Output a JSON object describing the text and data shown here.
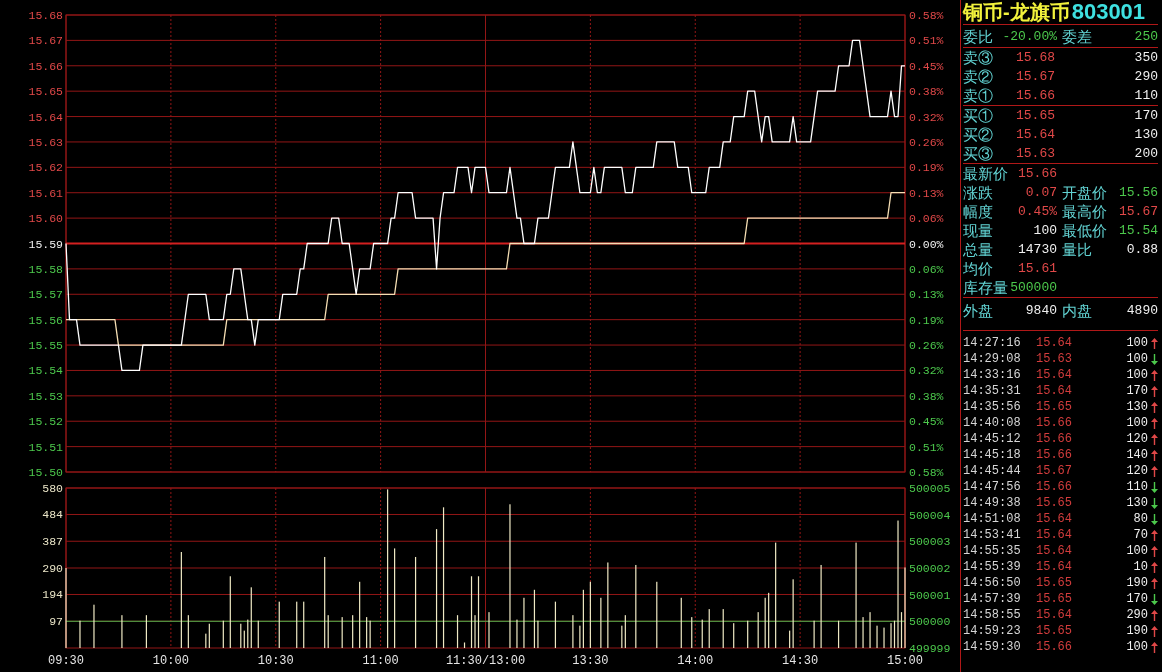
{
  "price_chart": {
    "chart_data": {
      "type": "line",
      "grid": true,
      "categories": [
        null,
        null,
        null,
        null,
        null,
        null,
        null,
        null,
        null,
        null,
        null,
        null,
        null,
        null,
        null,
        null,
        null,
        null,
        null,
        null,
        null,
        null,
        null,
        null,
        null,
        null,
        null,
        null,
        null,
        null,
        null,
        null,
        null,
        null,
        null,
        null,
        null,
        null,
        null,
        null,
        null,
        null,
        null,
        null,
        null,
        null,
        null,
        null,
        null,
        null,
        null,
        null,
        null,
        null,
        null,
        null,
        null,
        null,
        null,
        null,
        null,
        null,
        null,
        null,
        null,
        null,
        null,
        null,
        null,
        null,
        null,
        null,
        null,
        null,
        null,
        null,
        null,
        null,
        null,
        null,
        null,
        null,
        null,
        null,
        null,
        null,
        null,
        null,
        null,
        null,
        null,
        null,
        null,
        null,
        null,
        null,
        null,
        null,
        null,
        null,
        null,
        null,
        null,
        null,
        null,
        null,
        null,
        null,
        null,
        null,
        null,
        null,
        null,
        null,
        null,
        null,
        null,
        null,
        null,
        null,
        null,
        null,
        null,
        null,
        null,
        null,
        null,
        null,
        null,
        null,
        null,
        null,
        null,
        null,
        null,
        null,
        null,
        null,
        null,
        null,
        null,
        null,
        null,
        null,
        null,
        null,
        null,
        null,
        null,
        null,
        null,
        null,
        null,
        null,
        null,
        null,
        null,
        null,
        null,
        null,
        null,
        null,
        null,
        null,
        null,
        null,
        null,
        null,
        null,
        null,
        null,
        null,
        null,
        null,
        null,
        null,
        null,
        null,
        null,
        null,
        null,
        null,
        null,
        null,
        null,
        null,
        null,
        null,
        null,
        null,
        null,
        null,
        null,
        null,
        null,
        null,
        null,
        null,
        null,
        null,
        null,
        null,
        null,
        null,
        null,
        null,
        null,
        null,
        null,
        null,
        null,
        null,
        null,
        null,
        null,
        null,
        null,
        null,
        null,
        null,
        null,
        null,
        null,
        null,
        null,
        null,
        null,
        null,
        null,
        null,
        null,
        null,
        null,
        null,
        null,
        null,
        null,
        null,
        null,
        null,
        null
      ],
      "series": [
        {
          "color": "#ffffff",
          "values": [
            15.59,
            15.56,
            15.56,
            15.56,
            15.55,
            15.55,
            15.55,
            15.55,
            15.55,
            15.55,
            15.55,
            15.55,
            15.55,
            15.55,
            15.55,
            15.55,
            15.54,
            15.54,
            15.54,
            15.54,
            15.54,
            15.54,
            15.55,
            15.55,
            15.55,
            15.55,
            15.55,
            15.55,
            15.55,
            15.55,
            15.55,
            15.55,
            15.55,
            15.55,
            15.56,
            15.57,
            15.57,
            15.57,
            15.57,
            15.57,
            15.57,
            15.56,
            15.56,
            15.56,
            15.56,
            15.56,
            15.57,
            15.57,
            15.58,
            15.58,
            15.58,
            15.57,
            15.56,
            15.56,
            15.55,
            15.56,
            15.56,
            15.56,
            15.56,
            15.56,
            15.56,
            15.56,
            15.57,
            15.57,
            15.57,
            15.57,
            15.57,
            15.58,
            15.58,
            15.59,
            15.59,
            15.59,
            15.59,
            15.59,
            15.59,
            15.59,
            15.6,
            15.6,
            15.6,
            15.59,
            15.59,
            15.59,
            15.58,
            15.57,
            15.58,
            15.58,
            15.58,
            15.58,
            15.59,
            15.59,
            15.59,
            15.59,
            15.59,
            15.6,
            15.6,
            15.61,
            15.61,
            15.61,
            15.61,
            15.61,
            15.6,
            15.6,
            15.6,
            15.6,
            15.6,
            15.6,
            15.58,
            15.6,
            15.61,
            15.61,
            15.61,
            15.61,
            15.62,
            15.62,
            15.62,
            15.62,
            15.61,
            15.62,
            15.62,
            15.62,
            15.62,
            15.61,
            15.61,
            15.61,
            15.61,
            15.61,
            15.61,
            15.62,
            15.61,
            15.6,
            15.6,
            15.59,
            15.59,
            15.59,
            15.59,
            15.6,
            15.6,
            15.6,
            15.6,
            15.61,
            15.62,
            15.62,
            15.62,
            15.62,
            15.62,
            15.63,
            15.62,
            15.61,
            15.61,
            15.61,
            15.61,
            15.62,
            15.61,
            15.61,
            15.62,
            15.62,
            15.62,
            15.62,
            15.62,
            15.62,
            15.61,
            15.61,
            15.61,
            15.62,
            15.62,
            15.62,
            15.62,
            15.62,
            15.62,
            15.63,
            15.63,
            15.63,
            15.63,
            15.63,
            15.63,
            15.62,
            15.62,
            15.62,
            15.62,
            15.61,
            15.61,
            15.61,
            15.61,
            15.61,
            15.62,
            15.62,
            15.62,
            15.62,
            15.63,
            15.63,
            15.63,
            15.64,
            15.64,
            15.64,
            15.64,
            15.65,
            15.65,
            15.65,
            15.64,
            15.63,
            15.64,
            15.64,
            15.63,
            15.63,
            15.63,
            15.63,
            15.63,
            15.63,
            15.64,
            15.63,
            15.63,
            15.63,
            15.63,
            15.63,
            15.64,
            15.65,
            15.65,
            15.65,
            15.65,
            15.65,
            15.65,
            15.66,
            15.66,
            15.66,
            15.66,
            15.67,
            15.67,
            15.67,
            15.66,
            15.65,
            15.64,
            15.64,
            15.64,
            15.64,
            15.64,
            15.64,
            15.65,
            15.64,
            15.64,
            15.66,
            15.66
          ]
        },
        {
          "color": "#f5deb3",
          "values": [
            15.56,
            15.56,
            15.56,
            15.56,
            15.56,
            15.56,
            15.56,
            15.56,
            15.56,
            15.56,
            15.56,
            15.56,
            15.56,
            15.56,
            15.56,
            15.55,
            15.55,
            15.55,
            15.55,
            15.55,
            15.55,
            15.55,
            15.55,
            15.55,
            15.55,
            15.55,
            15.55,
            15.55,
            15.55,
            15.55,
            15.55,
            15.55,
            15.55,
            15.55,
            15.55,
            15.55,
            15.55,
            15.55,
            15.55,
            15.55,
            15.55,
            15.55,
            15.55,
            15.55,
            15.55,
            15.55,
            15.56,
            15.56,
            15.56,
            15.56,
            15.56,
            15.56,
            15.56,
            15.56,
            15.56,
            15.56,
            15.56,
            15.56,
            15.56,
            15.56,
            15.56,
            15.56,
            15.56,
            15.56,
            15.56,
            15.56,
            15.56,
            15.56,
            15.56,
            15.56,
            15.56,
            15.56,
            15.56,
            15.56,
            15.56,
            15.57,
            15.57,
            15.57,
            15.57,
            15.57,
            15.57,
            15.57,
            15.57,
            15.57,
            15.57,
            15.57,
            15.57,
            15.57,
            15.57,
            15.57,
            15.57,
            15.57,
            15.57,
            15.57,
            15.57,
            15.58,
            15.58,
            15.58,
            15.58,
            15.58,
            15.58,
            15.58,
            15.58,
            15.58,
            15.58,
            15.58,
            15.58,
            15.58,
            15.58,
            15.58,
            15.58,
            15.58,
            15.58,
            15.58,
            15.58,
            15.58,
            15.58,
            15.58,
            15.58,
            15.58,
            15.58,
            15.58,
            15.58,
            15.58,
            15.58,
            15.58,
            15.58,
            15.59,
            15.59,
            15.59,
            15.59,
            15.59,
            15.59,
            15.59,
            15.59,
            15.59,
            15.59,
            15.59,
            15.59,
            15.59,
            15.59,
            15.59,
            15.59,
            15.59,
            15.59,
            15.59,
            15.59,
            15.59,
            15.59,
            15.59,
            15.59,
            15.59,
            15.59,
            15.59,
            15.59,
            15.59,
            15.59,
            15.59,
            15.59,
            15.59,
            15.59,
            15.59,
            15.59,
            15.59,
            15.59,
            15.59,
            15.59,
            15.59,
            15.59,
            15.59,
            15.59,
            15.59,
            15.59,
            15.59,
            15.59,
            15.59,
            15.59,
            15.59,
            15.59,
            15.59,
            15.59,
            15.59,
            15.59,
            15.59,
            15.59,
            15.59,
            15.59,
            15.59,
            15.59,
            15.59,
            15.59,
            15.59,
            15.59,
            15.59,
            15.59,
            15.6,
            15.6,
            15.6,
            15.6,
            15.6,
            15.6,
            15.6,
            15.6,
            15.6,
            15.6,
            15.6,
            15.6,
            15.6,
            15.6,
            15.6,
            15.6,
            15.6,
            15.6,
            15.6,
            15.6,
            15.6,
            15.6,
            15.6,
            15.6,
            15.6,
            15.6,
            15.6,
            15.6,
            15.6,
            15.6,
            15.6,
            15.6,
            15.6,
            15.6,
            15.6,
            15.6,
            15.6,
            15.6,
            15.6,
            15.6,
            15.6,
            15.61,
            15.61,
            15.61,
            15.61,
            15.61
          ]
        }
      ],
      "ylim": [
        15.5,
        15.68
      ],
      "yticks": [
        {
          "value": 15.68,
          "label": "15.68"
        },
        {
          "value": 15.67,
          "label": "15.67"
        },
        {
          "value": 15.66,
          "label": "15.66"
        },
        {
          "value": 15.65,
          "label": "15.65"
        },
        {
          "value": 15.64,
          "label": "15.64"
        },
        {
          "value": 15.63,
          "label": "15.63"
        },
        {
          "value": 15.62,
          "label": "15.62"
        },
        {
          "value": 15.61,
          "label": "15.61"
        },
        {
          "value": 15.6,
          "label": "15.60"
        },
        {
          "value": 15.59,
          "label": "15.59"
        },
        {
          "value": 15.58,
          "label": "15.58"
        },
        {
          "value": 15.57,
          "label": "15.57"
        },
        {
          "value": 15.56,
          "label": "15.56"
        },
        {
          "value": 15.55,
          "label": "15.55"
        },
        {
          "value": 15.54,
          "label": "15.54"
        },
        {
          "value": 15.53,
          "label": "15.53"
        },
        {
          "value": 15.52,
          "label": "15.52"
        },
        {
          "value": 15.51,
          "label": "15.51"
        },
        {
          "value": 15.5,
          "label": "15.50"
        }
      ],
      "ref_lines": [
        {
          "axis": "y",
          "value": 15.59
        }
      ]
    },
    "right_axis": [
      "0.58%",
      "0.51%",
      "0.45%",
      "0.38%",
      "0.32%",
      "0.26%",
      "0.19%",
      "0.13%",
      "0.06%",
      "0.00%",
      "0.06%",
      "0.13%",
      "0.19%",
      "0.26%",
      "0.32%",
      "0.38%",
      "0.45%",
      "0.51%",
      "0.58%"
    ]
  },
  "volume_chart": {
    "chart_data": {
      "type": "bar",
      "grid": true,
      "categories": [
        "09:30",
        null,
        null,
        null,
        null,
        null,
        null,
        null,
        null,
        null,
        null,
        null,
        null,
        null,
        null,
        null,
        null,
        null,
        null,
        null,
        null,
        null,
        null,
        null,
        null,
        null,
        null,
        null,
        null,
        null,
        "10:00",
        null,
        null,
        null,
        null,
        null,
        null,
        null,
        null,
        null,
        null,
        null,
        null,
        null,
        null,
        null,
        null,
        null,
        null,
        null,
        null,
        null,
        null,
        null,
        null,
        null,
        null,
        null,
        null,
        null,
        "10:30",
        null,
        null,
        null,
        null,
        null,
        null,
        null,
        null,
        null,
        null,
        null,
        null,
        null,
        null,
        null,
        null,
        null,
        null,
        null,
        null,
        null,
        null,
        null,
        null,
        null,
        null,
        null,
        null,
        null,
        "11:00",
        null,
        null,
        null,
        null,
        null,
        null,
        null,
        null,
        null,
        null,
        null,
        null,
        null,
        null,
        null,
        null,
        null,
        null,
        null,
        null,
        null,
        null,
        null,
        null,
        null,
        null,
        null,
        null,
        null,
        "11:30/13:00",
        null,
        null,
        null,
        null,
        null,
        null,
        null,
        null,
        null,
        null,
        null,
        null,
        null,
        null,
        null,
        null,
        null,
        null,
        null,
        null,
        null,
        null,
        null,
        null,
        null,
        null,
        null,
        null,
        null,
        "13:30",
        null,
        null,
        null,
        null,
        null,
        null,
        null,
        null,
        null,
        null,
        null,
        null,
        null,
        null,
        null,
        null,
        null,
        null,
        null,
        null,
        null,
        null,
        null,
        null,
        null,
        null,
        null,
        null,
        null,
        "14:00",
        null,
        null,
        null,
        null,
        null,
        null,
        null,
        null,
        null,
        null,
        null,
        null,
        null,
        null,
        null,
        null,
        null,
        null,
        null,
        null,
        null,
        null,
        null,
        null,
        null,
        null,
        null,
        null,
        null,
        "14:30",
        null,
        null,
        null,
        null,
        null,
        null,
        null,
        null,
        null,
        null,
        null,
        null,
        null,
        null,
        null,
        null,
        null,
        null,
        null,
        null,
        null,
        null,
        null,
        null,
        null,
        null,
        null,
        null,
        null,
        "15:00"
      ],
      "series": [
        {
          "color": "#efe9c4",
          "values": [
            290,
            null,
            null,
            null,
            99,
            null,
            null,
            null,
            157,
            null,
            null,
            null,
            null,
            null,
            null,
            null,
            119,
            null,
            null,
            null,
            null,
            null,
            null,
            119,
            null,
            null,
            null,
            null,
            null,
            null,
            null,
            null,
            null,
            348,
            null,
            119,
            null,
            null,
            null,
            null,
            52,
            88,
            null,
            null,
            null,
            99,
            null,
            260,
            null,
            null,
            88,
            63,
            103,
            220,
            null,
            99,
            null,
            null,
            null,
            null,
            null,
            168,
            null,
            null,
            null,
            null,
            168,
            null,
            168,
            null,
            null,
            null,
            null,
            null,
            330,
            119,
            null,
            null,
            null,
            112,
            null,
            null,
            119,
            null,
            240,
            null,
            112,
            99,
            null,
            null,
            null,
            null,
            575,
            null,
            361,
            null,
            null,
            null,
            null,
            null,
            330,
            null,
            null,
            null,
            null,
            null,
            431,
            null,
            510,
            null,
            null,
            null,
            119,
            null,
            20,
            null,
            260,
            119,
            260,
            null,
            null,
            130,
            null,
            null,
            null,
            null,
            null,
            521,
            null,
            103,
            null,
            182,
            null,
            null,
            211,
            99,
            null,
            null,
            null,
            null,
            168,
            null,
            null,
            null,
            null,
            119,
            null,
            81,
            211,
            null,
            240,
            null,
            null,
            182,
            null,
            310,
            null,
            null,
            null,
            81,
            119,
            null,
            null,
            301,
            null,
            null,
            null,
            null,
            null,
            240,
            null,
            null,
            null,
            null,
            null,
            null,
            182,
            null,
            null,
            112,
            null,
            null,
            103,
            null,
            141,
            null,
            null,
            null,
            141,
            null,
            null,
            90,
            null,
            null,
            null,
            99,
            null,
            null,
            130,
            null,
            182,
            200,
            null,
            382,
            null,
            null,
            null,
            63,
            249,
            null,
            null,
            null,
            null,
            null,
            99,
            null,
            301,
            null,
            null,
            null,
            null,
            99,
            null,
            null,
            null,
            null,
            382,
            null,
            112,
            null,
            130,
            null,
            81,
            null,
            74,
            null,
            90,
            99,
            462,
            130,
            292
          ]
        }
      ],
      "ylim": [
        0,
        580
      ],
      "yticks": [
        97,
        194,
        290,
        387,
        484,
        580
      ],
      "ref_lines": [
        {
          "axis": "y",
          "value": 97
        }
      ]
    },
    "right_axis": [
      "500005",
      "500004",
      "500003",
      "500002",
      "500001",
      "500000",
      "499999"
    ]
  },
  "quote": {
    "name": "铜币-龙旗币",
    "code": "803001",
    "order_row": [
      {
        "label": "委比",
        "value": "-20.00%"
      },
      {
        "label": "委差",
        "value": "250"
      }
    ],
    "asks": [
      {
        "label": "卖③",
        "price": "15.68",
        "volume": "350"
      },
      {
        "label": "卖②",
        "price": "15.67",
        "volume": "290"
      },
      {
        "label": "卖①",
        "price": "15.66",
        "volume": "110"
      }
    ],
    "bids": [
      {
        "label": "买①",
        "price": "15.65",
        "volume": "170"
      },
      {
        "label": "买②",
        "price": "15.64",
        "volume": "130"
      },
      {
        "label": "买③",
        "price": "15.63",
        "volume": "200"
      }
    ],
    "stats": [
      [
        {
          "label": "最新价",
          "value": "15.66",
          "color": "#e04848"
        }
      ],
      [
        {
          "label": "涨跌",
          "value": "0.07",
          "color": "#e04848"
        },
        {
          "label": "开盘价",
          "value": "15.56",
          "color": "#4cc84c"
        }
      ],
      [
        {
          "label": "幅度",
          "value": "0.45%",
          "color": "#e04848"
        },
        {
          "label": "最高价",
          "value": "15.67",
          "color": "#e04848"
        }
      ],
      [
        {
          "label": "现量",
          "value": "100",
          "color": "#f0f0f0"
        },
        {
          "label": "最低价",
          "value": "15.54",
          "color": "#4cc84c"
        }
      ],
      [
        {
          "label": "总量",
          "value": "14730",
          "color": "#f0f0f0"
        },
        {
          "label": "量比",
          "value": "0.88",
          "color": "#f0f0f0"
        }
      ],
      [
        {
          "label": "均价",
          "value": "15.61",
          "color": "#e04848"
        }
      ],
      [
        {
          "label": "库存量",
          "value": "500000",
          "color": "#4cc84c"
        }
      ]
    ],
    "volume_split": [
      {
        "label": "外盘",
        "value": "9840"
      },
      {
        "label": "内盘",
        "value": "4890"
      }
    ]
  },
  "trades": [
    {
      "time": "14:27:16",
      "price": "15.64",
      "volume": "100",
      "kind": "up"
    },
    {
      "time": "14:29:08",
      "price": "15.63",
      "volume": "100",
      "kind": "down"
    },
    {
      "time": "14:33:16",
      "price": "15.64",
      "volume": "100",
      "kind": "up"
    },
    {
      "time": "14:35:31",
      "price": "15.64",
      "volume": "170",
      "kind": "up"
    },
    {
      "time": "14:35:56",
      "price": "15.65",
      "volume": "130",
      "kind": "up"
    },
    {
      "time": "14:40:08",
      "price": "15.66",
      "volume": "100",
      "kind": "up"
    },
    {
      "time": "14:45:12",
      "price": "15.66",
      "volume": "120",
      "kind": "up"
    },
    {
      "time": "14:45:18",
      "price": "15.66",
      "volume": "140",
      "kind": "up"
    },
    {
      "time": "14:45:44",
      "price": "15.67",
      "volume": "120",
      "kind": "up"
    },
    {
      "time": "14:47:56",
      "price": "15.66",
      "volume": "110",
      "kind": "down"
    },
    {
      "time": "14:49:38",
      "price": "15.65",
      "volume": "130",
      "kind": "down"
    },
    {
      "time": "14:51:08",
      "price": "15.64",
      "volume": "80",
      "kind": "down"
    },
    {
      "time": "14:53:41",
      "price": "15.64",
      "volume": "70",
      "kind": "up"
    },
    {
      "time": "14:55:35",
      "price": "15.64",
      "volume": "100",
      "kind": "up"
    },
    {
      "time": "14:55:39",
      "price": "15.64",
      "volume": "10",
      "kind": "up"
    },
    {
      "time": "14:56:50",
      "price": "15.65",
      "volume": "190",
      "kind": "up"
    },
    {
      "time": "14:57:39",
      "price": "15.65",
      "volume": "170",
      "kind": "down"
    },
    {
      "time": "14:58:55",
      "price": "15.64",
      "volume": "290",
      "kind": "up"
    },
    {
      "time": "14:59:23",
      "price": "15.65",
      "volume": "190",
      "kind": "up"
    },
    {
      "time": "14:59:30",
      "price": "15.66",
      "volume": "100",
      "kind": "up"
    }
  ]
}
